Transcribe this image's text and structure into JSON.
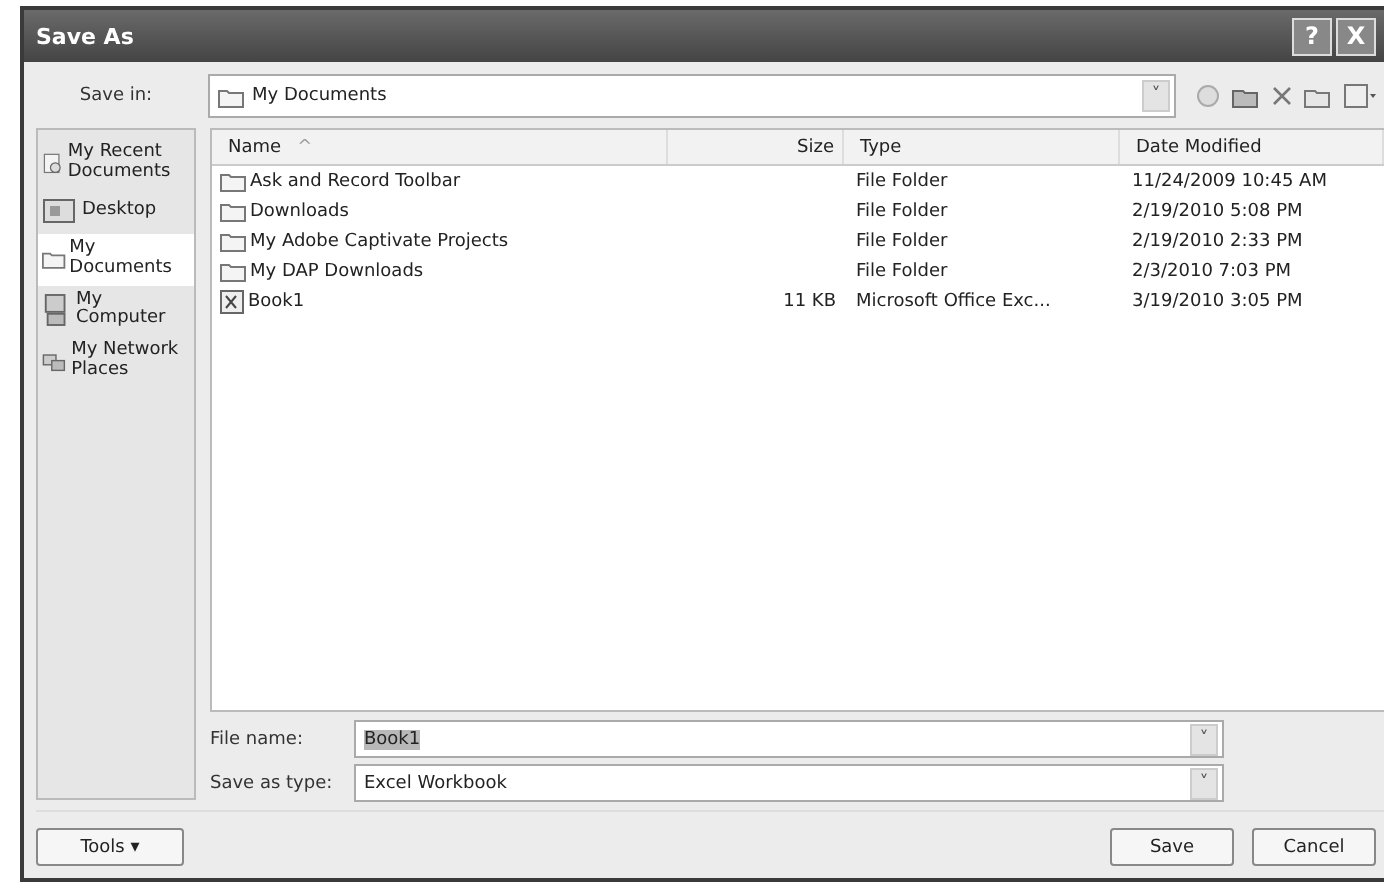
{
  "window": {
    "title": "Save As",
    "help": "?",
    "close": "X"
  },
  "save_in": {
    "label": "Save in:",
    "value": "My Documents",
    "arrow": "˅"
  },
  "sidebar": {
    "items": [
      {
        "label": "My Recent Documents",
        "kind": "recent",
        "selected": false
      },
      {
        "label": "Desktop",
        "kind": "desktop",
        "selected": false
      },
      {
        "label": "My Documents",
        "kind": "documents",
        "selected": true
      },
      {
        "label": "My Computer",
        "kind": "computer",
        "selected": false
      },
      {
        "label": "My Network Places",
        "kind": "network",
        "selected": false
      }
    ]
  },
  "table": {
    "columns": [
      "Name",
      "Size",
      "Type",
      "Date Modified"
    ],
    "sort_arrow": "^",
    "rows": [
      {
        "kind": "folder",
        "name": "Ask and Record Toolbar",
        "size": "",
        "type": "File Folder",
        "date": "11/24/2009 10:45 AM"
      },
      {
        "kind": "folder",
        "name": "Downloads",
        "size": "",
        "type": "File Folder",
        "date": "2/19/2010 5:08 PM"
      },
      {
        "kind": "folder",
        "name": "My Adobe Captivate Projects",
        "size": "",
        "type": "File Folder",
        "date": "2/19/2010 2:33 PM"
      },
      {
        "kind": "folder",
        "name": "My DAP Downloads",
        "size": "",
        "type": "File Folder",
        "date": "2/3/2010 7:03 PM"
      },
      {
        "kind": "workbook",
        "name": "Book1",
        "size": "11 KB",
        "type": "Microsoft Office Exc...",
        "date": "3/19/2010 3:05 PM"
      }
    ]
  },
  "file_name": {
    "label": "File name:",
    "value": "Book1",
    "selected": true,
    "arrow": "˅"
  },
  "save_as_type": {
    "label": "Save as type:",
    "value": "Excel Workbook",
    "arrow": "˅"
  },
  "buttons": {
    "tools": "Tools",
    "tools_arrow": "▾",
    "save": "Save",
    "cancel": "Cancel"
  }
}
